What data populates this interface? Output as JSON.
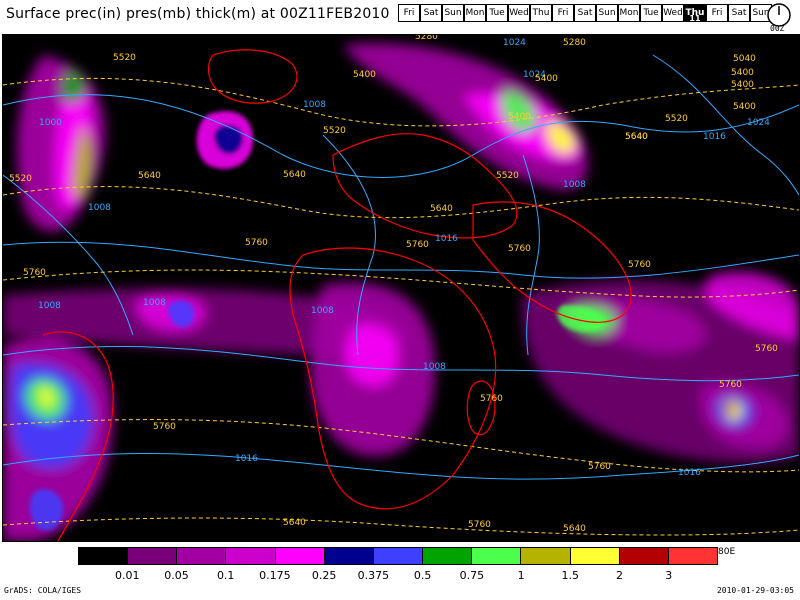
{
  "header": {
    "title": "Surface prec(in) pres(mb) thick(m) at 00Z11FEB2010"
  },
  "day_strip": {
    "days": [
      "Fri",
      "Sat",
      "Sun",
      "Mon",
      "Tue",
      "Wed",
      "Thu",
      "Fri",
      "Sat",
      "Sun",
      "Mon",
      "Tue",
      "Wed",
      "Thu",
      "Fri",
      "Sat",
      "Sun"
    ],
    "active_index": 13,
    "active_date": "11"
  },
  "clock": {
    "label": "00Z"
  },
  "map": {
    "pressure_labels": [
      "1008",
      "1008",
      "1008",
      "1008",
      "1008",
      "1016",
      "1008",
      "1016",
      "1024",
      "1016",
      "1008",
      "1016",
      "1000",
      "1024",
      "1024"
    ],
    "thickness_labels": [
      "5520",
      "5640",
      "5520",
      "5640",
      "5400",
      "5400",
      "5520",
      "5400",
      "5280",
      "5400",
      "5400",
      "5520",
      "5040",
      "5400",
      "5640",
      "5760",
      "5760",
      "5760",
      "5760",
      "5760",
      "5760",
      "5760",
      "5760",
      "5760",
      "5640",
      "5640",
      "5760",
      "5280",
      "5640",
      "5520",
      "5640",
      "5760"
    ],
    "colors": {
      "background": "#000000",
      "coast": "#ff0000",
      "isobar": "#33aaff",
      "thickness": "#ffcc33"
    }
  },
  "legend": {
    "colors": [
      "#000000",
      "#7a007a",
      "#a300a3",
      "#cc00cc",
      "#ff00ff",
      "#00008f",
      "#3f3fff",
      "#00a300",
      "#4cff4c",
      "#b3b300",
      "#ffff33",
      "#b30000",
      "#ff3333"
    ],
    "ticks": [
      "0.01",
      "0.05",
      "0.1",
      "0.175",
      "0.25",
      "0.375",
      "0.5",
      "0.75",
      "1",
      "1.5",
      "2",
      "3"
    ],
    "extra_label": "80E"
  },
  "footer": {
    "left": "GrADS: COLA/IGES",
    "right": "2010-01-29-03:05"
  }
}
